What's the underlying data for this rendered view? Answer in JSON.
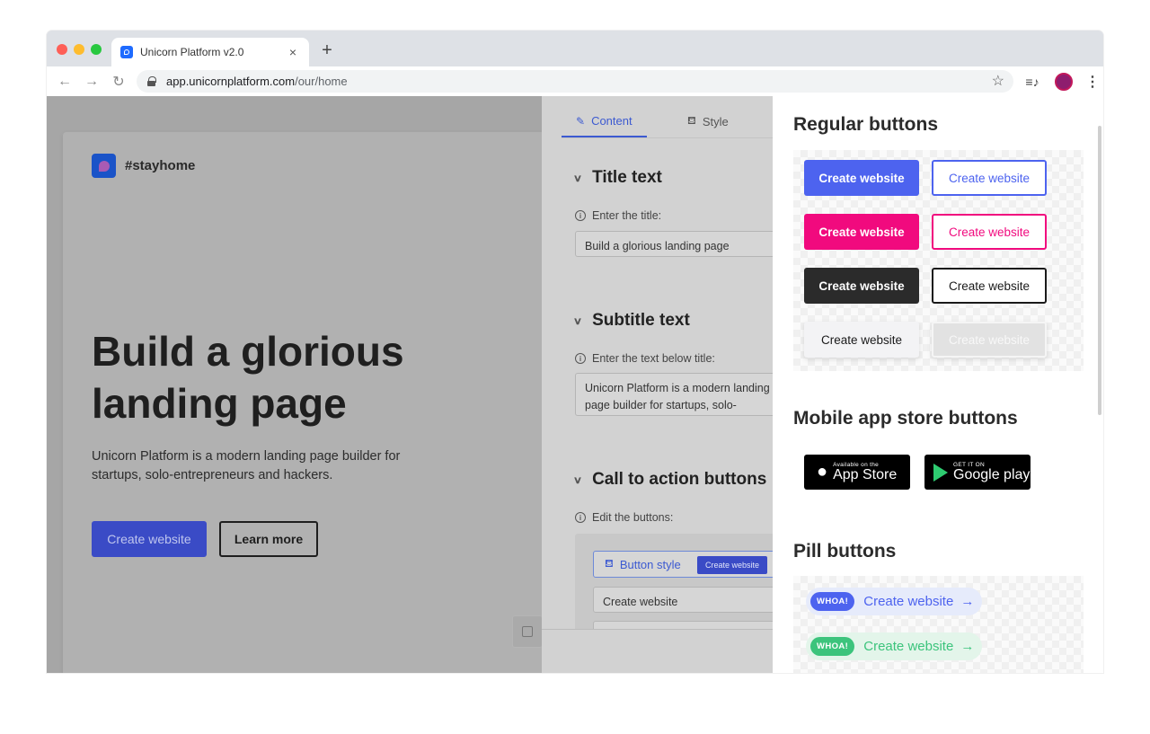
{
  "browser": {
    "tab_title": "Unicorn Platform v2.0",
    "tab_close": "×",
    "new_tab": "+",
    "url_host": "app.unicornplatform.com",
    "url_path": "/our/home",
    "nav_back": "←",
    "nav_forward": "→",
    "nav_reload": "↻",
    "star": "☆",
    "media": "≡♪",
    "menu": "⋮"
  },
  "page": {
    "brand": "#stayhome",
    "hero_title": "Build a glorious landing page",
    "hero_subtitle": "Unicorn Platform is a modern landing page builder for startups, solo-entrepreneurs and hackers.",
    "primary_button": "Create website",
    "secondary_button": "Learn more"
  },
  "editor": {
    "tab_content": "Content",
    "tab_style": "Style",
    "sections": [
      {
        "title": "Title text",
        "hint": "Enter the title:",
        "value": "Build a glorious landing page"
      },
      {
        "title": "Subtitle text",
        "hint": "Enter the text below title:",
        "value": "Unicorn Platform is a modern landing page builder for startups, solo-entrepreneurs and hackers."
      },
      {
        "title": "Call to action buttons",
        "hint": "Edit the buttons:",
        "value": "Create website"
      }
    ],
    "button_style_label": "Button style",
    "button_style_preview": "Create website"
  },
  "panel": {
    "regular_heading": "Regular buttons",
    "regular_button_label": "Create website",
    "mobile_heading": "Mobile app store buttons",
    "appstore_small": "Available on the",
    "appstore_big": "App Store",
    "googleplay_small": "GET IT ON",
    "googleplay_big": "Google play",
    "pill_heading": "Pill buttons",
    "pill_badge": "WHOA!",
    "pill_label": "Create website",
    "pill_arrow": "→"
  },
  "colors": {
    "accent_blue": "#4d63ef",
    "accent_pink": "#f10a7e",
    "accent_green": "#3cc47c",
    "dark": "#2b2b2b"
  }
}
